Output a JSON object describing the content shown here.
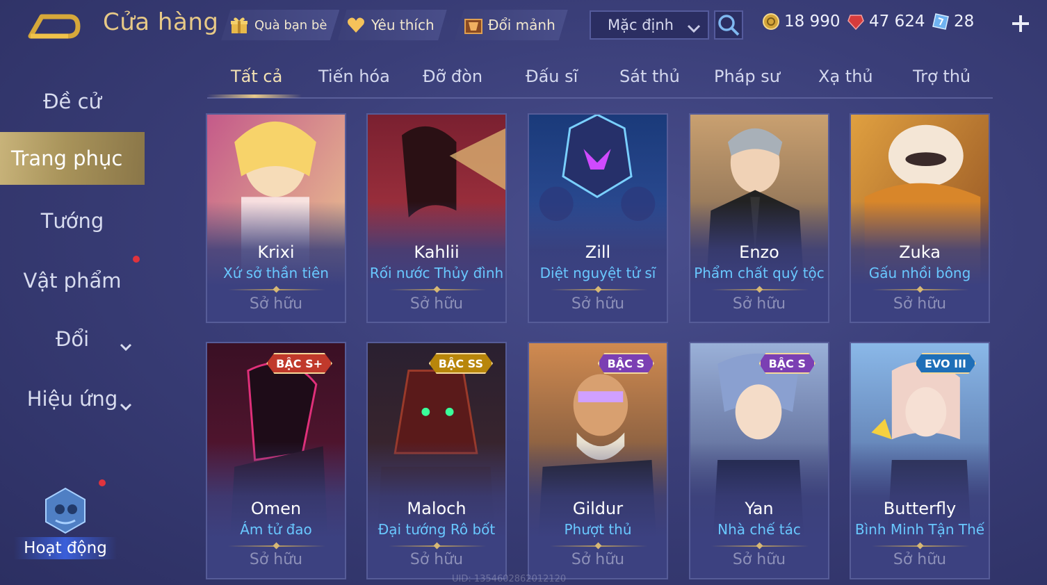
{
  "header": {
    "title": "Cửa hàng",
    "friend_gift": "Quà bạn bè",
    "favorite": "Yêu thích",
    "exchange_fragments": "Đổi mảnh",
    "sort_value": "Mặc định",
    "currencies": [
      {
        "icon": "gold-coin-icon",
        "value": "18 990"
      },
      {
        "icon": "red-gem-icon",
        "value": "47 624"
      },
      {
        "icon": "voucher-icon",
        "value": "28"
      }
    ]
  },
  "sidebar": {
    "items": [
      {
        "label": "Đề cử"
      },
      {
        "label": "Trang phục"
      },
      {
        "label": "Tướng"
      },
      {
        "label": "Vật phẩm"
      },
      {
        "label": "Đổi"
      },
      {
        "label": "Hiệu ứng"
      }
    ],
    "event_label": "Hoạt động"
  },
  "tabs": [
    "Tất cả",
    "Tiến hóa",
    "Đỡ đòn",
    "Đấu sĩ",
    "Sát thủ",
    "Pháp sư",
    "Xạ thủ",
    "Trợ thủ"
  ],
  "cards": [
    {
      "hero": "Krixi",
      "skin": "Xứ sở thần tiên",
      "status": "Sở hữu",
      "badge": ""
    },
    {
      "hero": "Kahlii",
      "skin": "Rối nước Thủy đình",
      "status": "Sở hữu",
      "badge": ""
    },
    {
      "hero": "Zill",
      "skin": "Diệt nguyệt tử sĩ",
      "status": "Sở hữu",
      "badge": ""
    },
    {
      "hero": "Enzo",
      "skin": "Phẩm chất quý tộc",
      "status": "Sở hữu",
      "badge": ""
    },
    {
      "hero": "Zuka",
      "skin": "Gấu nhồi bông",
      "status": "Sở hữu",
      "badge": ""
    },
    {
      "hero": "Omen",
      "skin": "Ám tử đao",
      "status": "Sở hữu",
      "badge": "BẬC S+"
    },
    {
      "hero": "Maloch",
      "skin": "Đại tướng Rô bốt",
      "status": "Sở hữu",
      "badge": "BẬC SS"
    },
    {
      "hero": "Gildur",
      "skin": "Phượt thủ",
      "status": "Sở hữu",
      "badge": "BẬC S"
    },
    {
      "hero": "Yan",
      "skin": "Nhà chế tác",
      "status": "Sở hữu",
      "badge": "BẬC S"
    },
    {
      "hero": "Butterfly",
      "skin": "Bình Minh Tận Thế",
      "status": "Sở hữu",
      "badge": "EVO III"
    }
  ],
  "uid_text": "UID: 1354602862012120",
  "colors": {
    "title_gold": "#e7c987",
    "skin_blue": "#69c8ff",
    "owned_gray": "#8d90b8",
    "active_tab": "#f3e2b4",
    "badge_s_plus": "#c0392b",
    "badge_ss": "#b8860b",
    "badge_s": "#7b3fb3",
    "badge_evo": "#1f6fb8"
  }
}
